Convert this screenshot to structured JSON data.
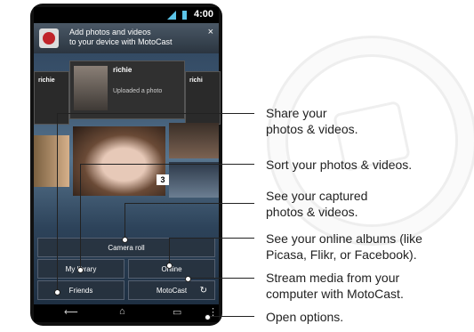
{
  "status_bar": {
    "time": "4:00"
  },
  "notification": {
    "line1": "Add photos and videos",
    "line2": "to your device with MotoCast",
    "close": "×"
  },
  "feed": {
    "center_name": "richie",
    "center_status": "Uploaded a photo",
    "left_name": "richie",
    "right_name": "richi"
  },
  "gallery": {
    "badge_count": "3"
  },
  "buttons": {
    "camera_roll": "Camera roll",
    "my_library": "My library",
    "online": "Online",
    "friends": "Friends",
    "motocast": "MotoCast"
  },
  "icons": {
    "refresh": "refresh-icon",
    "back": "back-icon",
    "home": "home-icon",
    "recent": "recent-apps-icon",
    "menu": "menu-icon"
  },
  "callouts": {
    "share_l1": "Share your",
    "share_l2": "photos & videos.",
    "sort": "Sort your photos & videos.",
    "captured_l1": "See your captured",
    "captured_l2": "photos & videos.",
    "online_l1": "See your online albums (like",
    "online_l2": "Picasa, Flikr, or Facebook).",
    "stream_l1": "Stream media from your",
    "stream_l2": "computer with MotoCast.",
    "options": "Open options."
  }
}
